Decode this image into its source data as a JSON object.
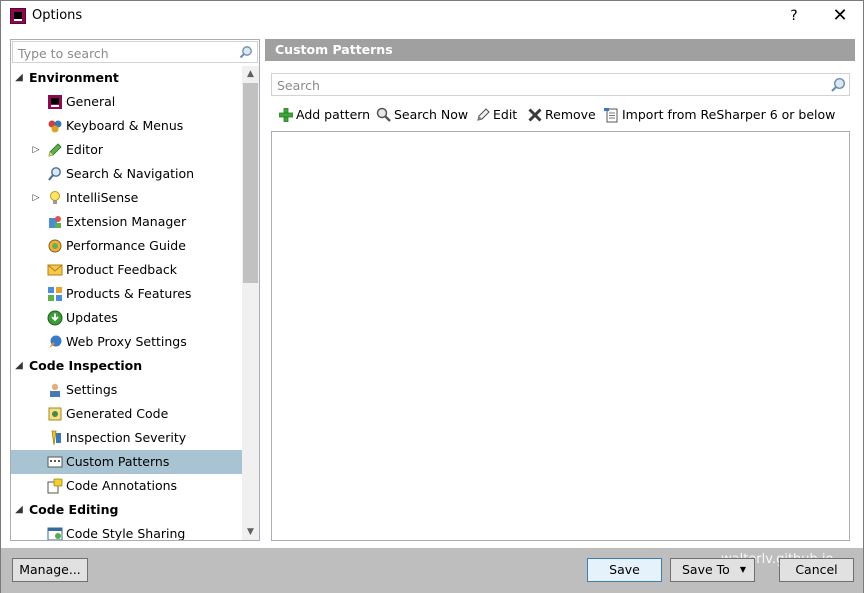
{
  "window": {
    "title": "Options",
    "help_label": "?",
    "close_label": "✕"
  },
  "left_search": {
    "placeholder": "Type to search"
  },
  "tree": {
    "items": [
      {
        "type": "group",
        "label": "Environment",
        "icon": "collapse-arrow"
      },
      {
        "type": "item",
        "label": "General",
        "icon": "resharper-icon"
      },
      {
        "type": "item",
        "label": "Keyboard & Menus",
        "icon": "keyboard-icon"
      },
      {
        "type": "item",
        "label": "Editor",
        "icon": "pencil-icon",
        "expandable": true
      },
      {
        "type": "item",
        "label": "Search & Navigation",
        "icon": "magnifier-icon"
      },
      {
        "type": "item",
        "label": "IntelliSense",
        "icon": "lightbulb-icon",
        "expandable": true
      },
      {
        "type": "item",
        "label": "Extension Manager",
        "icon": "extension-icon"
      },
      {
        "type": "item",
        "label": "Performance Guide",
        "icon": "performance-icon"
      },
      {
        "type": "item",
        "label": "Product Feedback",
        "icon": "envelope-icon"
      },
      {
        "type": "item",
        "label": "Products & Features",
        "icon": "products-icon"
      },
      {
        "type": "item",
        "label": "Updates",
        "icon": "updates-icon"
      },
      {
        "type": "item",
        "label": "Web Proxy Settings",
        "icon": "proxy-icon"
      },
      {
        "type": "group",
        "label": "Code Inspection",
        "icon": "collapse-arrow"
      },
      {
        "type": "item",
        "label": "Settings",
        "icon": "settings-user-icon"
      },
      {
        "type": "item",
        "label": "Generated Code",
        "icon": "generated-code-icon"
      },
      {
        "type": "item",
        "label": "Inspection Severity",
        "icon": "severity-icon"
      },
      {
        "type": "item",
        "label": "Custom Patterns",
        "icon": "custom-patterns-icon",
        "selected": true
      },
      {
        "type": "item",
        "label": "Code Annotations",
        "icon": "annotations-icon"
      },
      {
        "type": "group",
        "label": "Code Editing",
        "icon": "collapse-arrow"
      },
      {
        "type": "item",
        "label": "Code Style Sharing",
        "icon": "code-style-icon"
      }
    ]
  },
  "panel": {
    "header": "Custom Patterns",
    "search_placeholder": "Search",
    "toolbar": {
      "add": "Add pattern",
      "search_now": "Search Now",
      "edit": "Edit",
      "remove": "Remove",
      "import": "Import from ReSharper 6 or below"
    }
  },
  "footer": {
    "manage": "Manage...",
    "save": "Save",
    "save_to": "Save To",
    "cancel": "Cancel",
    "watermark": "walterlv.github.io"
  },
  "colors": {
    "selected_row": "#a8c4d2",
    "header_bg": "#a0a0a0",
    "footer_bg": "#bebebe",
    "accent_button_border": "#3c7fb1"
  }
}
